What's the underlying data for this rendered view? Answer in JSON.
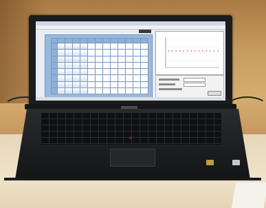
{
  "scene": {
    "description_items": [
      "laptop",
      "screen",
      "plate-layout grid",
      "line graph",
      "keyboard",
      "touchpad"
    ],
    "colors": {
      "wall": "#c79a5e",
      "desk": "#efe3cc",
      "laptop_body": "#1c1d20",
      "plate_panel": "#9bb9dc",
      "graph_line": "#d94040"
    }
  },
  "plate": {
    "rows": 8,
    "columns": 12
  },
  "graph": {
    "series_color": "#d94040",
    "series_points": 14
  }
}
